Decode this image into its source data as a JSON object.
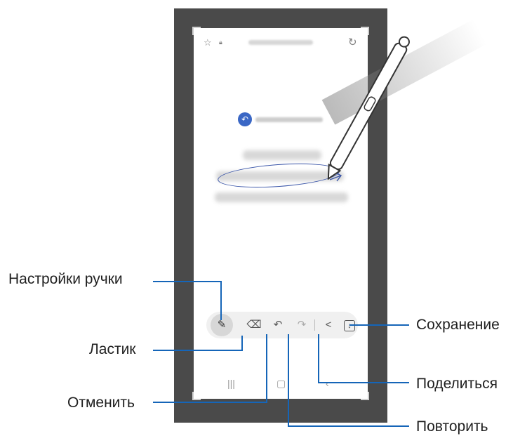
{
  "labels": {
    "pen_settings": "Настройки ручки",
    "eraser": "Ластик",
    "undo": "Отменить",
    "save": "Сохранение",
    "share": "Поделиться",
    "redo": "Повторить"
  },
  "colors": {
    "callout_line": "#1565b8",
    "phone_frame": "#4a4a4a",
    "ink": "#3a55a8"
  },
  "toolbar_icons": [
    "pen-icon",
    "eraser-icon",
    "undo-icon",
    "redo-icon",
    "share-icon",
    "save-icon"
  ],
  "navbar_icons": [
    "recents-icon",
    "home-icon",
    "back-icon"
  ]
}
